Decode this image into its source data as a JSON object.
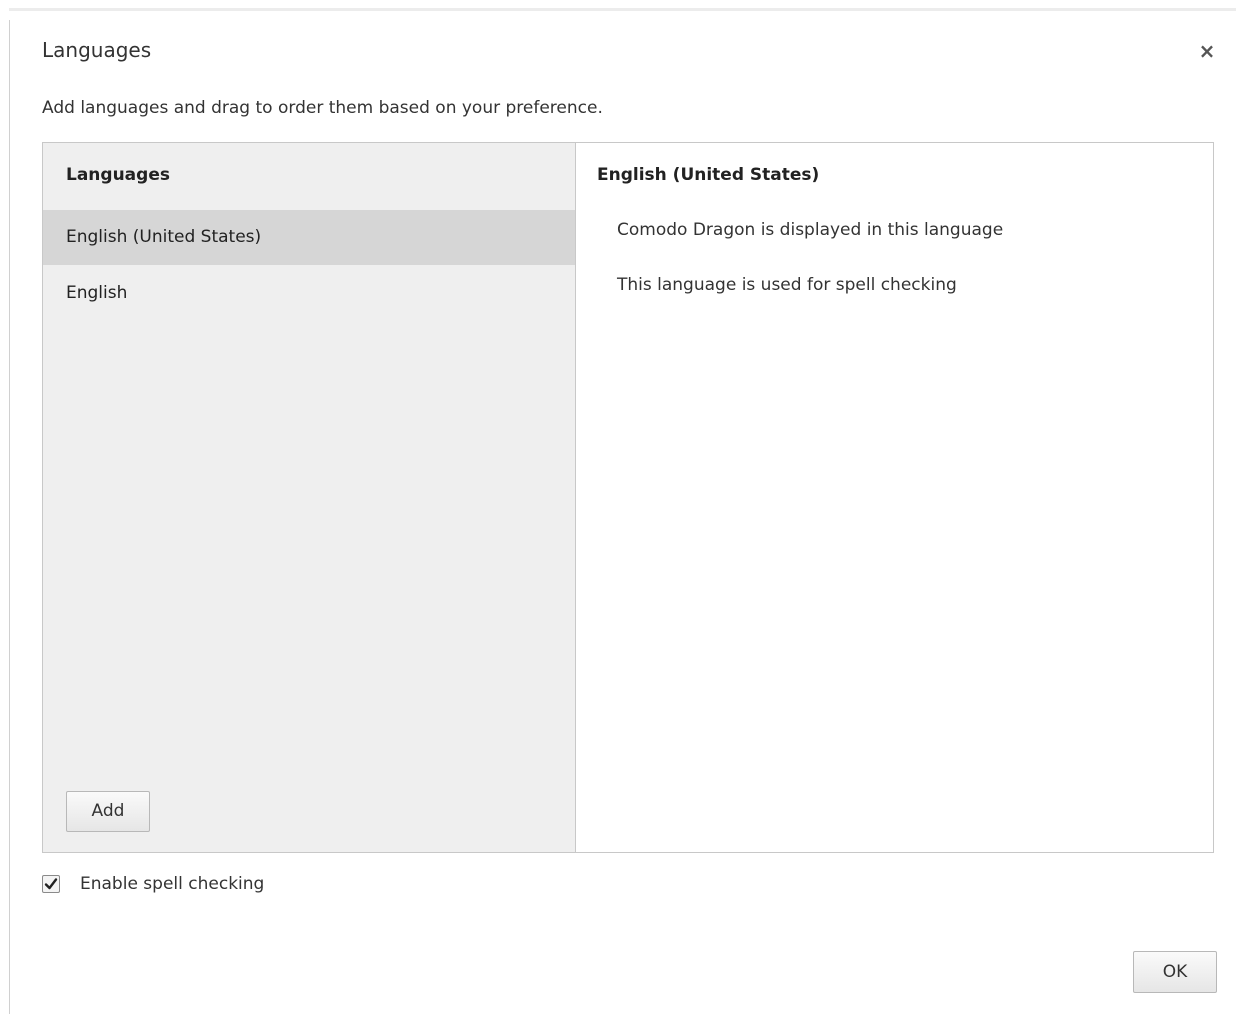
{
  "dialog": {
    "title": "Languages",
    "close_glyph": "×",
    "subtitle": "Add languages and drag to order them based on your preference."
  },
  "language_list": {
    "header": "Languages",
    "items": [
      {
        "label": "English (United States)",
        "selected": true
      },
      {
        "label": "English",
        "selected": false
      }
    ],
    "add_label": "Add"
  },
  "detail": {
    "title": "English (United States)",
    "lines": [
      "Comodo Dragon is displayed in this language",
      "This language is used for spell checking"
    ]
  },
  "spell_check": {
    "label": "Enable spell checking",
    "checked": true
  },
  "footer": {
    "ok_label": "OK"
  },
  "icons": {
    "close": "close-icon",
    "check": "checkmark-icon"
  },
  "colors": {
    "list_background": "#efefef",
    "selected_row": "#d6d6d6",
    "border": "#c8c8c8"
  }
}
